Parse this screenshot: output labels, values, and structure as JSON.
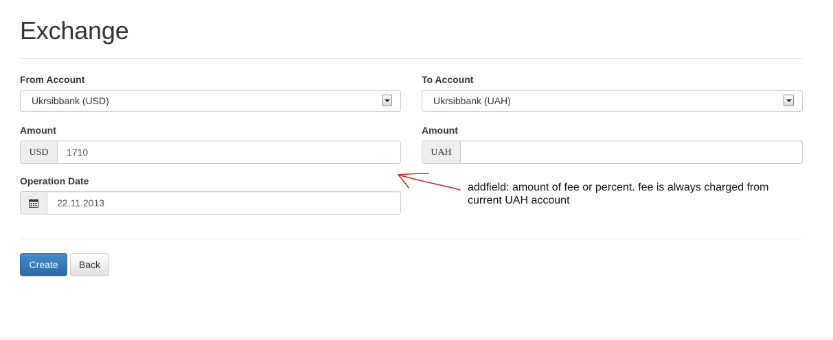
{
  "page": {
    "title": "Exchange"
  },
  "form": {
    "from_account": {
      "label": "From Account",
      "value": "Ukrsibbank (USD)"
    },
    "to_account": {
      "label": "To Account",
      "value": "Ukrsibbank (UAH)"
    },
    "amount_from": {
      "label": "Amount",
      "currency": "USD",
      "value": "1710"
    },
    "amount_to": {
      "label": "Amount",
      "currency": "UAH",
      "value": ""
    },
    "operation_date": {
      "label": "Operation Date",
      "value": "22.11.2013"
    }
  },
  "annotation": {
    "text": "addfield: amount of fee or percent. fee is always charged from current UAH account",
    "color": "#e0201c"
  },
  "actions": {
    "create_label": "Create",
    "back_label": "Back"
  },
  "colors": {
    "primary": "#428bca",
    "border": "#cccccc",
    "addon_bg": "#eeeeee"
  }
}
